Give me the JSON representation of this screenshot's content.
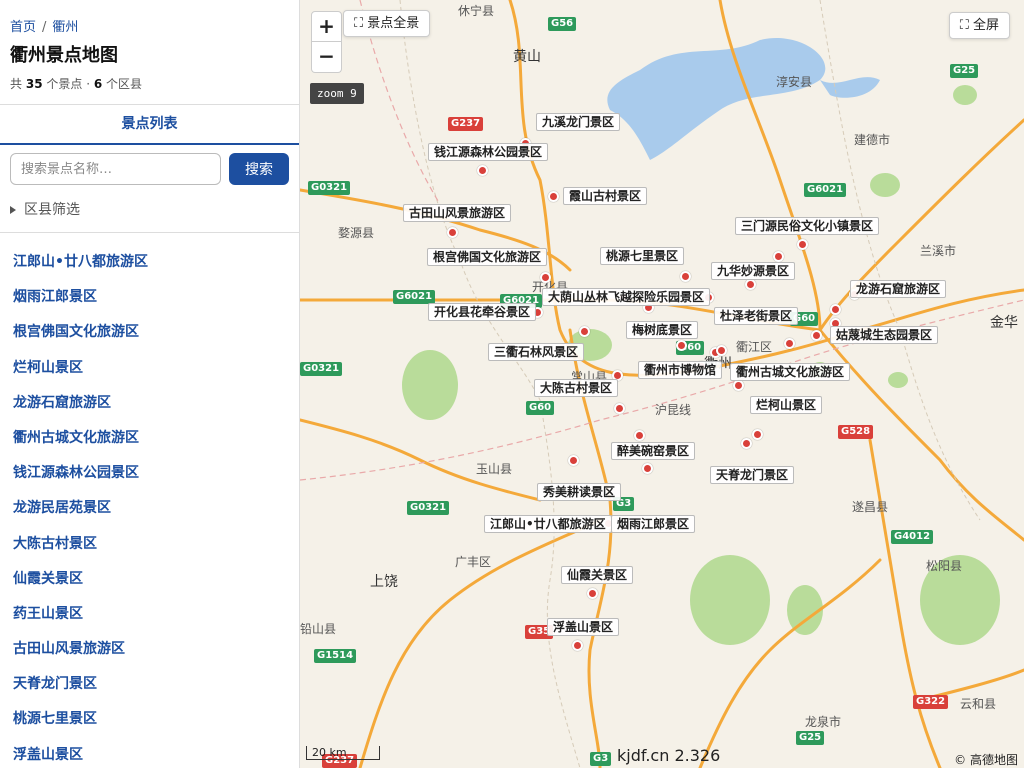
{
  "sidebar": {
    "breadcrumb": {
      "home": "首页",
      "separator": "/",
      "current": "衢州"
    },
    "title": "衢州景点地图",
    "stats": {
      "prefix": "共",
      "spots": "35",
      "spots_unit": "个景点 ·",
      "districts": "6",
      "districts_unit": "个区县"
    },
    "tab_label": "景点列表",
    "search": {
      "placeholder": "搜索景点名称…",
      "button": "搜索"
    },
    "filter_label": "区县筛选",
    "items": [
      "江郎山•廿八都旅游区",
      "烟雨江郎景区",
      "根宫佛国文化旅游区",
      "烂柯山景区",
      "龙游石窟旅游区",
      "衢州古城文化旅游区",
      "钱江源森林公园景区",
      "龙游民居苑景区",
      "大陈古村景区",
      "仙霞关景区",
      "药王山景区",
      "古田山风景旅游区",
      "天脊龙门景区",
      "桃源七里景区",
      "浮盖山景区"
    ]
  },
  "map": {
    "zoom_in": "+",
    "zoom_out": "−",
    "fit_all": "⛶ 景点全景",
    "fullscreen": "⛶ 全屏",
    "zoom_tag": "zoom 9",
    "scale": "20 km",
    "watermark": "kjdf.cn 2.326",
    "attribution": "© 高德地图",
    "labels": {
      "l1": "九溪龙门景区",
      "l2": "钱江源森林公园景区",
      "l3": "霞山古村景区",
      "l4": "古田山风景旅游区",
      "l5": "三门源民俗文化小镇景区",
      "l6": "根宫佛国文化旅游区",
      "l7": "桃源七里景区",
      "l8": "九华妙源景区",
      "l9": "龙游石窟旅游区",
      "l10": "大荫山丛林飞越探险乐园景区",
      "l11": "开化县花牵谷景区",
      "l12": "杜泽老街景区",
      "l13": "梅树底景区",
      "l14": "姑蔑城生态园景区",
      "l15": "三衢石林风景区",
      "l16": "衢州市博物馆",
      "l17": "衢州古城文化旅游区",
      "l18": "大陈古村景区",
      "l19": "烂柯山景区",
      "l20": "醉美碗窑景区",
      "l21": "天脊龙门景区",
      "l22": "秀美耕读景区",
      "l23": "江郎山•廿八都旅游区",
      "l24": "烟雨江郎景区",
      "l25": "仙霞关景区",
      "l26": "浮盖山景区"
    },
    "places": {
      "huangshan": "黄山",
      "chunan": "淳安县",
      "jiande": "建德市",
      "wuyuan": "婺源县",
      "lanxi": "兰溪市",
      "jinhua": "金华",
      "kaihua": "开化县",
      "quzhou": "衢州",
      "qujiang": "衢江区",
      "changshan": "常山县",
      "yushan": "玉山县",
      "guangfeng": "广丰区",
      "shangrao": "上饶",
      "suichang": "遂昌县",
      "songyang": "松阳县",
      "longquan": "龙泉市",
      "yunhe": "云和县",
      "xiuning": "休宁县",
      "huxian": "沪昆线",
      "qianshan": "铅山县"
    },
    "shields": {
      "s1": "G56",
      "s2": "G237",
      "s3": "G0321",
      "s4": "G6021",
      "s5": "G6021",
      "s6": "G6021",
      "s7": "G60",
      "s8": "G60",
      "s9": "G60",
      "s10": "G25",
      "s11": "G528",
      "s12": "G3",
      "s13": "G0321",
      "s14": "G4012",
      "s15": "G35",
      "s16": "G1514",
      "s17": "G322",
      "s18": "G25",
      "s19": "G3",
      "s20": "G237",
      "s21": "G0321"
    },
    "colors": {
      "land": "#f5f1e8",
      "water": "#a9cbec",
      "green": "#b9dc9a",
      "road": "#f4a93a",
      "marker": "#d9403a",
      "accent": "#1d4fa0"
    }
  }
}
